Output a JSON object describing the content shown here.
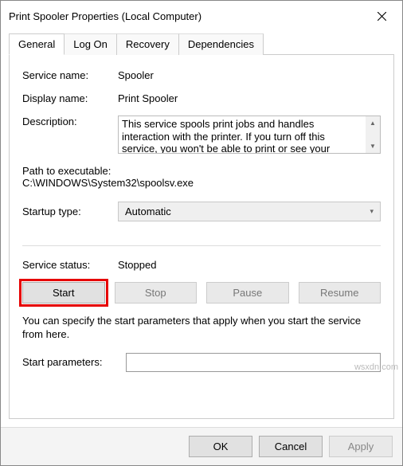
{
  "window": {
    "title": "Print Spooler Properties (Local Computer)"
  },
  "tabs": {
    "general": "General",
    "logon": "Log On",
    "recovery": "Recovery",
    "dependencies": "Dependencies"
  },
  "labels": {
    "service_name": "Service name:",
    "display_name": "Display name:",
    "description": "Description:",
    "path": "Path to executable:",
    "startup": "Startup type:",
    "status": "Service status:",
    "hint": "You can specify the start parameters that apply when you start the service from here.",
    "start_params": "Start parameters:"
  },
  "values": {
    "service_name": "Spooler",
    "display_name": "Print Spooler",
    "description": "This service spools print jobs and handles interaction with the printer.  If you turn off this service, you won't be able to print or see your printers.",
    "path": "C:\\WINDOWS\\System32\\spoolsv.exe",
    "startup": "Automatic",
    "status": "Stopped",
    "start_params": ""
  },
  "buttons": {
    "start": "Start",
    "stop": "Stop",
    "pause": "Pause",
    "resume": "Resume",
    "ok": "OK",
    "cancel": "Cancel",
    "apply": "Apply"
  },
  "watermark": "wsxdn.com"
}
